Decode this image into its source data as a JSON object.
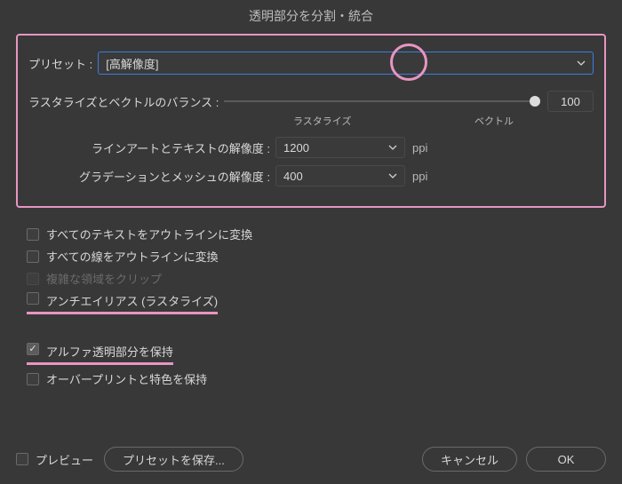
{
  "title": "透明部分を分割・統合",
  "preset": {
    "label": "プリセット :",
    "value": "[高解像度]"
  },
  "balance": {
    "label": "ラスタライズとベクトルのバランス :",
    "value": "100",
    "left_sub": "ラスタライズ",
    "right_sub": "ベクトル"
  },
  "lineart": {
    "label": "ラインアートとテキストの解像度 :",
    "value": "1200",
    "unit": "ppi"
  },
  "gradient": {
    "label": "グラデーションとメッシュの解像度 :",
    "value": "400",
    "unit": "ppi"
  },
  "checks": {
    "text_outline": "すべてのテキストをアウトラインに変換",
    "stroke_outline": "すべての線をアウトラインに変換",
    "clip_complex": "複雑な領域をクリップ",
    "antialias": "アンチエイリアス (ラスタライズ)",
    "alpha": "アルファ透明部分を保持",
    "overprint": "オーバープリントと特色を保持"
  },
  "footer": {
    "preview": "プレビュー",
    "save_preset": "プリセットを保存...",
    "cancel": "キャンセル",
    "ok": "OK"
  }
}
